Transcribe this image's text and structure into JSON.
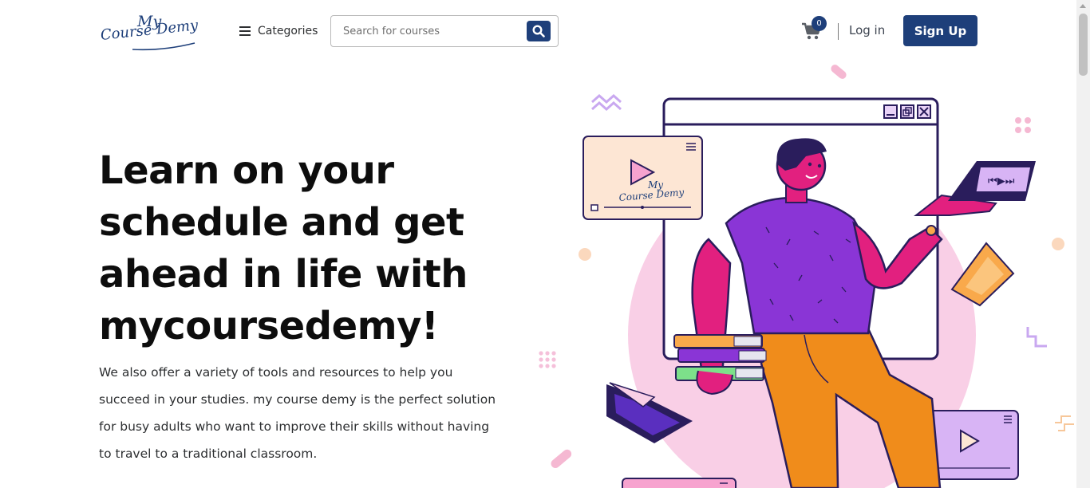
{
  "header": {
    "logo": {
      "line1": "My",
      "line2": "Course Demy"
    },
    "categories_label": "Categories",
    "search": {
      "placeholder": "Search for courses"
    },
    "cart": {
      "count": "0"
    },
    "login_label": "Log in",
    "signup_label": "Sign Up"
  },
  "hero": {
    "title": "Learn on your schedule and get ahead in life with mycoursedemy!",
    "description": "We also offer a variety of tools and resources to help you succeed in your studies. my course demy is the perfect solution for busy adults who want to improve their skills without having to travel to a traditional classroom."
  },
  "illustration": {
    "video_card_logo_line1": "My",
    "video_card_logo_line2": "Course Demy"
  },
  "colors": {
    "brand": "#1e3f7a",
    "pink_circle": "#f9cfe6",
    "shirt": "#8a35d6",
    "skin": "#e2207f",
    "pants": "#f08c1b",
    "outline": "#2a1d5c"
  },
  "icons": [
    "hamburger-icon",
    "search-icon",
    "cart-icon",
    "play-icon",
    "window-minimize-icon",
    "window-restore-icon",
    "window-close-icon"
  ]
}
